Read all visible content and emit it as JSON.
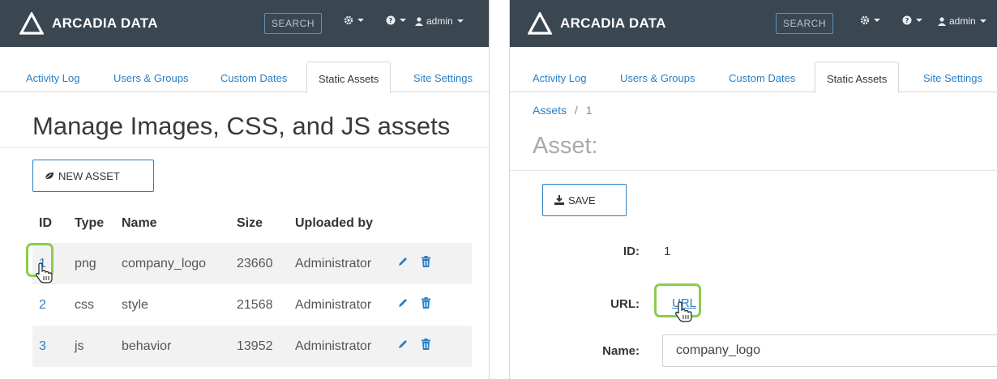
{
  "brand": {
    "name": "ARCADIA DATA"
  },
  "navbar": {
    "search_label": "SEARCH",
    "user_label": "admin",
    "icons": [
      "gear-icon",
      "help-icon",
      "user-icon"
    ]
  },
  "tabs": [
    {
      "label": "Activity Log",
      "active": false
    },
    {
      "label": "Users & Groups",
      "active": false
    },
    {
      "label": "Custom Dates",
      "active": false
    },
    {
      "label": "Static Assets",
      "active": true
    },
    {
      "label": "Site Settings",
      "active": false
    }
  ],
  "assets_list": {
    "title": "Manage Images, CSS, and JS assets",
    "new_asset_label": "NEW ASSET",
    "columns": [
      "ID",
      "Type",
      "Name",
      "Size",
      "Uploaded by"
    ],
    "rows": [
      {
        "id": "1",
        "type": "png",
        "name": "company_logo",
        "size": "23660",
        "uploaded_by": "Administrator"
      },
      {
        "id": "2",
        "type": "css",
        "name": "style",
        "size": "21568",
        "uploaded_by": "Administrator"
      },
      {
        "id": "3",
        "type": "js",
        "name": "behavior",
        "size": "13952",
        "uploaded_by": "Administrator"
      }
    ]
  },
  "asset_detail": {
    "breadcrumb_root": "Assets",
    "breadcrumb_sep": "/",
    "breadcrumb_current": "1",
    "title": "Asset:",
    "save_label": "SAVE",
    "id_label": "ID:",
    "id_value": "1",
    "url_label": "URL:",
    "url_link_text": "URL",
    "name_label": "Name:",
    "name_value": "company_logo"
  },
  "colors": {
    "navbar_bg": "#3a4650",
    "link": "#2a7fc4",
    "highlight": "#8ccc4c",
    "stripe": "#f2f2f2"
  }
}
